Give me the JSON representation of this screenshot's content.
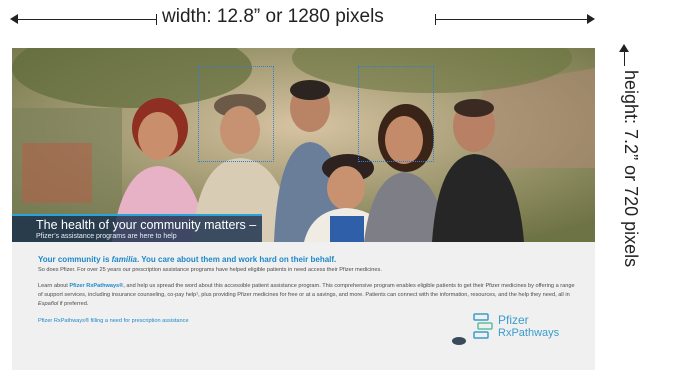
{
  "annotations": {
    "width_label": "width: 12.8” or 1280 pixels",
    "height_label": "height: 7.2” or 720 pixels"
  },
  "hero": {
    "headline": "The health of your community matters –",
    "subhead": "Pfizer’s assistance programs are here to help"
  },
  "body": {
    "heading_start": "Your community is ",
    "heading_em": "familia",
    "heading_end": ". You care about them and work hard on their behalf.",
    "para1": "So does Pfizer. For over 25 years our prescription assistance programs have helped eligible patients in need access their Pfizer medicines.",
    "para2_a": "Learn about ",
    "para2_brand": "Pfizer RxPathways®",
    "para2_b": ", and help us spread the word about this accessible patient assistance program. This comprehensive program enables eligible patients to get their Pfizer medicines by offering a range of support services, including insurance counseling, co-pay help¹, plus providing Pfizer medicines for free or at a savings, and more. Patients can connect with the information, resources, and the help they need, all in ",
    "para2_em": "Español",
    "para2_c": " if preferred.",
    "tagline": "Pfizer RxPathways® filling a need for prescription assistance"
  },
  "logo": {
    "line1": "Pfizer",
    "line2": "RxPathways"
  },
  "colors": {
    "accent": "#1d88c8",
    "banner": "#18304e",
    "logo": "#3a9ccc"
  }
}
